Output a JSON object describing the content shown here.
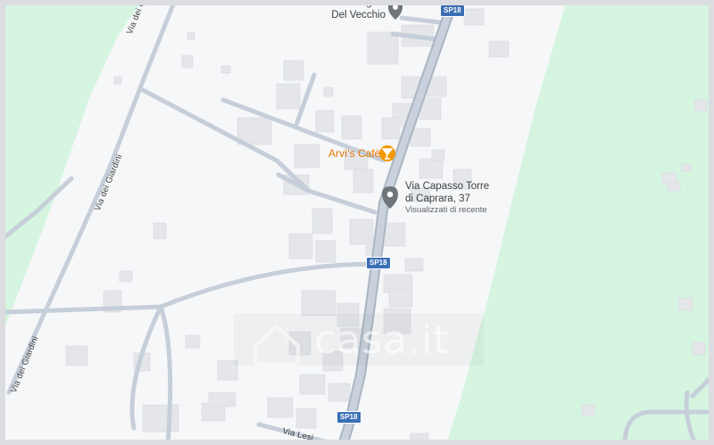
{
  "map": {
    "pois": [
      {
        "name_line1": "Studio Legale",
        "name_line2": "Del Vecchio"
      },
      {
        "name": "Arvì's Cafè"
      },
      {
        "name_line1": "Via Capasso Torre",
        "name_line2": "di Caprara, 37",
        "sub": "Visualizzati di recente"
      }
    ],
    "roads": {
      "giardini_1": "Via dei Giardini",
      "giardini_2": "Via dei Giardini",
      "giardini_3": "Via dei Giardini",
      "lesina": "Via Lesi"
    },
    "shields": [
      "SP18",
      "SP18",
      "SP18"
    ],
    "watermark": "casa.it",
    "colors": {
      "land": "#f6f7f8",
      "green": "#d5f5e1",
      "road": "#c6cfd9",
      "road_outline": "#aab6c2",
      "building": "#e6e8eb",
      "highway_shield": "#3b6fb6",
      "poi_pin": "#70757a",
      "cafe_pin": "#f29900"
    },
    "icons": [
      "location-pin-icon",
      "cafe-pin-icon",
      "house-icon"
    ]
  }
}
